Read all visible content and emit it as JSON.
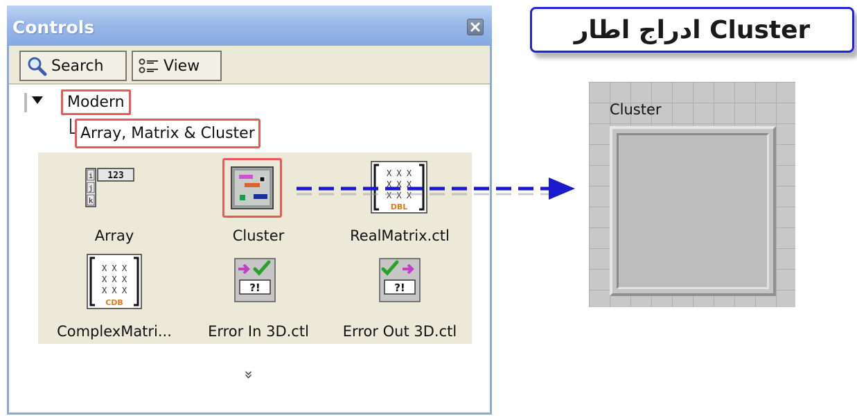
{
  "window": {
    "title": "Controls",
    "close_icon": "close-icon"
  },
  "toolbar": {
    "search_label": "Search",
    "view_label": "View"
  },
  "tree": {
    "root": "Modern",
    "child": "Array, Matrix & Cluster"
  },
  "palette": {
    "items": [
      {
        "label": "Array",
        "icon": "array-icon"
      },
      {
        "label": "Cluster",
        "icon": "cluster-icon"
      },
      {
        "label": "RealMatrix.ctl",
        "icon": "real-matrix-icon"
      },
      {
        "label": "ComplexMatri...",
        "icon": "complex-matrix-icon"
      },
      {
        "label": "Error In 3D.ctl",
        "icon": "error-in-icon"
      },
      {
        "label": "Error Out 3D.ctl",
        "icon": "error-out-icon"
      }
    ],
    "more_icon": "double-chevron-down-icon",
    "more_glyph": "»"
  },
  "icon_text": {
    "array_index": [
      "i",
      "j",
      "k"
    ],
    "array_value": "123",
    "matrix_x": "X X X",
    "real_badge": "DBL",
    "complex_badge": "CDB",
    "error_glyph": "?!"
  },
  "heading": {
    "text": "ادراج اطار Cluster"
  },
  "preview": {
    "label": "Cluster"
  },
  "colors": {
    "highlight_red": "#e85a5a",
    "arrow_blue": "#1a1acc",
    "heading_border": "#2222dd",
    "titlebar": "#9ab9e9",
    "palette_bg": "#ece9d8"
  }
}
